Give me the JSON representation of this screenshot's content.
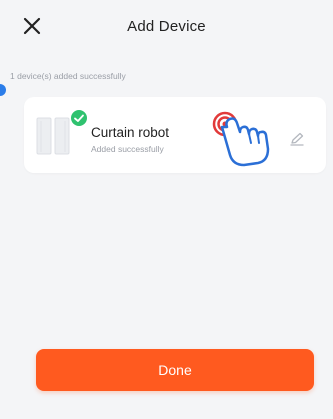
{
  "header": {
    "title": "Add Device",
    "close_icon": "close-icon"
  },
  "result": {
    "summary": "1 device(s) added successfully"
  },
  "device": {
    "name": "Curtain robot",
    "status": "Added successfully",
    "image": "curtain-robot-image",
    "badge_icon": "check-circle-icon",
    "edit_icon": "pencil-icon"
  },
  "overlay": {
    "pointer_icon": "tap-hand-icon"
  },
  "footer": {
    "done_label": "Done"
  },
  "colors": {
    "background": "#f4f5f7",
    "card": "#ffffff",
    "accent": "#ff5a1f",
    "success": "#2fc26f",
    "indicator": "#2b7de9",
    "pointer": "#2b6fd6",
    "tap": "#e23a3a"
  }
}
